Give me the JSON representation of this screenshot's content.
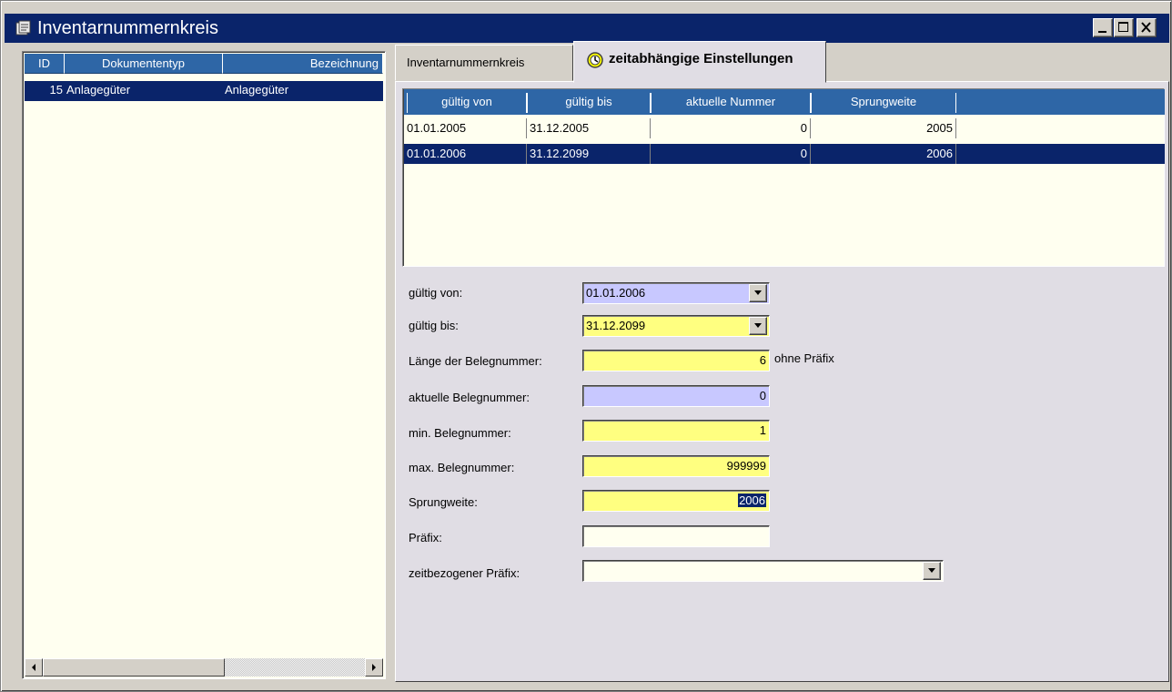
{
  "window": {
    "title": "Inventarnummernkreis",
    "icon": "app-document-icon"
  },
  "left_list": {
    "columns": [
      "ID",
      "Dokumententyp",
      "Bezeichnung"
    ],
    "rows": [
      {
        "id": "15",
        "dokumententyp": "Anlagegüter",
        "bezeichnung": "Anlagegüter",
        "selected": true
      }
    ]
  },
  "tabs": [
    {
      "label": "Inventarnummernkreis",
      "active": false
    },
    {
      "label": "zeitabhängige Einstellungen",
      "active": true,
      "icon": "clock-icon"
    }
  ],
  "grid": {
    "columns": [
      "gültig von",
      "gültig bis",
      "aktuelle Nummer",
      "Sprungweite"
    ],
    "rows": [
      {
        "gueltig_von": "01.01.2005",
        "gueltig_bis": "31.12.2005",
        "aktuelle_nummer": "0",
        "sprungweite": "2005",
        "selected": false
      },
      {
        "gueltig_von": "01.01.2006",
        "gueltig_bis": "31.12.2099",
        "aktuelle_nummer": "0",
        "sprungweite": "2006",
        "selected": true
      }
    ]
  },
  "form": {
    "gueltig_von": {
      "label": "gültig von:",
      "value": "01.01.2006"
    },
    "gueltig_bis": {
      "label": "gültig bis:",
      "value": "31.12.2099"
    },
    "laenge": {
      "label": "Länge der Belegnummer:",
      "value": "6",
      "note": "ohne Präfix"
    },
    "aktuelle": {
      "label": "aktuelle Belegnummer:",
      "value": "0"
    },
    "min": {
      "label": "min. Belegnummer:",
      "value": "1"
    },
    "max": {
      "label": "max. Belegnummer:",
      "value": "999999"
    },
    "sprungweite": {
      "label": "Sprungweite:",
      "value": "2006"
    },
    "praefix": {
      "label": "Präfix:",
      "value": ""
    },
    "zeit_praefix": {
      "label": "zeitbezogener Präfix:",
      "value": ""
    }
  },
  "colors": {
    "titlebar": "#0a246a",
    "header": "#2e66a6",
    "selection": "#0a246a",
    "required": "#ffff80",
    "readonly": "#c8c8ff",
    "list_bg": "#fffff0"
  }
}
